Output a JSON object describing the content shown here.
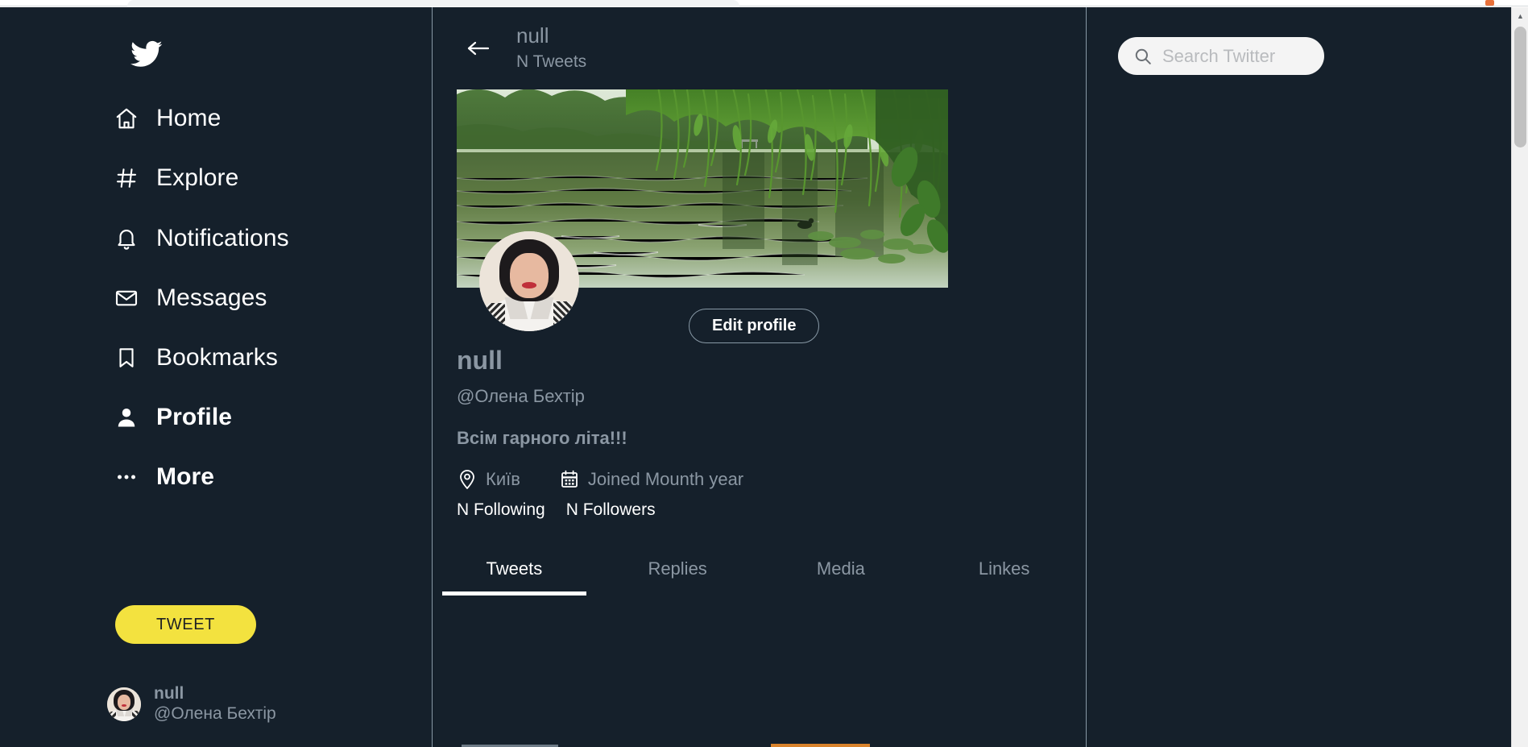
{
  "theme": {
    "background": "#15202b",
    "accent_yellow": "#f3e23f",
    "muted_text": "#8b97a3",
    "primary_text": "#ffffff",
    "border": "#8899a6",
    "search_background": "#f4f4f4"
  },
  "brand": {
    "logo_icon": "twitter-bird-icon",
    "logo_label": "Twitter"
  },
  "sidebar": {
    "items": [
      {
        "label": "Home",
        "icon": "home-icon",
        "bold": false
      },
      {
        "label": "Explore",
        "icon": "hashtag-icon",
        "bold": false
      },
      {
        "label": "Notifications",
        "icon": "bell-icon",
        "bold": false
      },
      {
        "label": "Messages",
        "icon": "envelope-icon",
        "bold": false
      },
      {
        "label": "Bookmarks",
        "icon": "bookmark-icon",
        "bold": false
      },
      {
        "label": "Profile",
        "icon": "person-icon",
        "bold": true
      },
      {
        "label": "More",
        "icon": "ellipsis-icon",
        "bold": true
      }
    ],
    "tweet_button_label": "TWEET",
    "account": {
      "name": "null",
      "handle": "@Олена Бехтір",
      "avatar_icon": "user-avatar"
    }
  },
  "header": {
    "back_icon": "arrow-left-icon",
    "title": "null",
    "subtitle": "N Tweets"
  },
  "search": {
    "icon": "search-icon",
    "placeholder": "Search Twitter",
    "value": ""
  },
  "profile": {
    "banner_alt": "lake-banner-image",
    "avatar_alt": "profile-avatar-image",
    "edit_button_label": "Edit profile",
    "name": "null",
    "handle": "@Олена Бехтір",
    "bio": "Всім гарного літа!!!",
    "location_icon": "location-pin-icon",
    "location": "Київ",
    "joined_icon": "calendar-icon",
    "joined": "Joined Mounth year",
    "following": "N Following",
    "followers": "N Followers"
  },
  "tabs": [
    {
      "label": "Tweets",
      "active": true
    },
    {
      "label": "Replies",
      "active": false
    },
    {
      "label": "Media",
      "active": false
    },
    {
      "label": "Linkes",
      "active": false
    }
  ],
  "scrollbar": {
    "up_arrow_glyph": "▲"
  }
}
